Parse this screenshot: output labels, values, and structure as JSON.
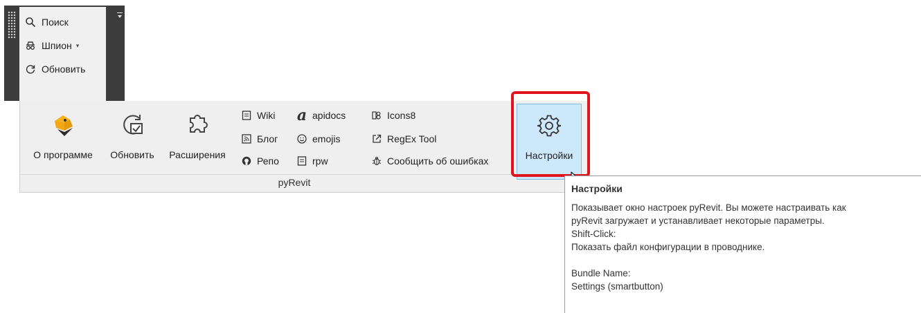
{
  "tools_panel": {
    "items": [
      {
        "label": "Поиск",
        "icon": "search-icon"
      },
      {
        "label": "Шпион",
        "icon": "spy-icon",
        "has_dropdown": true
      },
      {
        "label": "Обновить",
        "icon": "refresh-icon"
      }
    ]
  },
  "ribbon": {
    "panel_title": "pyRevit",
    "big_buttons": [
      {
        "label": "О программе",
        "icon": "pyrevit-logo-icon"
      },
      {
        "label": "Обновить",
        "icon": "update-icon"
      },
      {
        "label": "Расширения",
        "icon": "puzzle-icon"
      }
    ],
    "small_items_col1": [
      {
        "label": "Wiki",
        "icon": "document-icon"
      },
      {
        "label": "Блог",
        "icon": "rss-icon"
      },
      {
        "label": "Репо",
        "icon": "github-icon"
      }
    ],
    "small_items_col2": [
      {
        "label": "apidocs",
        "icon": "script-a-icon"
      },
      {
        "label": "emojis",
        "icon": "smiley-icon"
      },
      {
        "label": "rpw",
        "icon": "document-icon"
      }
    ],
    "small_items_col3": [
      {
        "label": "Icons8",
        "icon": "icons8-icon"
      },
      {
        "label": "RegEx Tool",
        "icon": "external-link-icon"
      },
      {
        "label": "Сообщить об ошибках",
        "icon": "bug-icon"
      }
    ],
    "settings_button": {
      "label": "Настройки",
      "icon": "gear-icon"
    }
  },
  "tooltip": {
    "title": "Настройки",
    "lines": [
      "Показывает окно настроек pyRevit. Вы можете настраивать как",
      "pyRevit загружает и устанавливает некоторые параметры.",
      "Shift-Click:",
      "Показать файл конфигурации в проводнике."
    ],
    "lines2": [
      "Bundle Name:",
      "Settings (smartbutton)"
    ]
  },
  "colors": {
    "highlight_border": "#e0141e",
    "button_hover_fill": "#cde8fb",
    "dark_panel": "#3c3c3c"
  }
}
